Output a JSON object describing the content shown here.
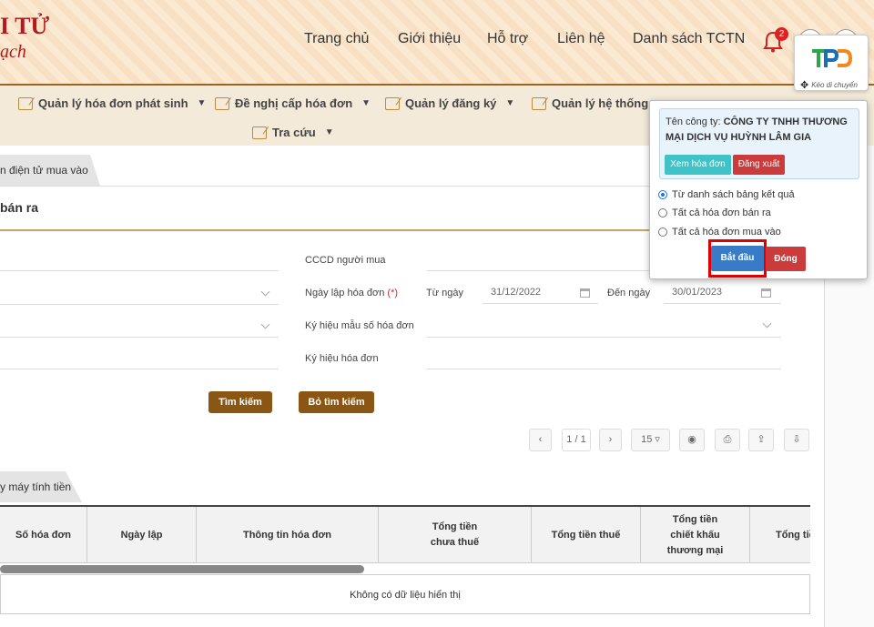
{
  "header": {
    "logo_text": "I TỬ",
    "logo_sub": "ạch",
    "nav": [
      "Trang chủ",
      "Giới thiệu",
      "Hỗ trợ",
      "Liên hệ",
      "Danh sách TCTN"
    ],
    "notification_count": "2"
  },
  "menu": [
    {
      "label": "Quản lý hóa đơn phát sinh"
    },
    {
      "label": "Đề nghị cấp hóa đơn"
    },
    {
      "label": "Quản lý đăng ký"
    },
    {
      "label": "Quản lý hệ thống"
    },
    {
      "label": "Tra cứu"
    }
  ],
  "tabs": {
    "top": "n điện tử mua vào",
    "bottom": "y máy tính tiền"
  },
  "page_title": "bán ra",
  "form": {
    "cccd_label": "CCCD người mua",
    "date_label": "Ngày lập hóa đơn",
    "required_mark": "(*)",
    "from_label": "Từ ngày",
    "from_value": "31/12/2022",
    "to_label": "Đến ngày",
    "to_value": "30/01/2023",
    "template_label": "Ký hiệu mẫu số hóa đơn",
    "symbol_label": "Ký hiệu hóa đơn",
    "search_btn": "Tìm kiếm",
    "clear_btn": "Bỏ tìm kiếm"
  },
  "pagination": {
    "page": "1 / 1",
    "page_size": "15"
  },
  "table": {
    "headers": [
      "Số hóa đơn",
      "Ngày lập",
      "Thông tin hóa đơn",
      "Tổng tiền chưa thuế",
      "Tổng tiền thuế",
      "Tổng tiền chiết khấu thương mại",
      "Tổng tiề"
    ],
    "empty": "Không có dữ liệu hiển thị"
  },
  "popup": {
    "company_label": "Tên công ty:",
    "company_name": "CÔNG TY TNHH THƯƠNG MẠI DỊCH VỤ HUỲNH LÂM GIA",
    "view_btn": "Xem hóa đơn",
    "logout_btn": "Đăng xuất",
    "options": [
      "Từ danh sách bảng kết quả",
      "Tất cả hóa đơn bán ra",
      "Tất cả hóa đơn mua vào"
    ],
    "selected_option": 0,
    "start_btn": "Bắt đầu",
    "close_btn": "Đóng"
  },
  "widget": {
    "logo": "TPD",
    "drag_label": "Kéo di chuyển"
  },
  "colors": {
    "brand_red": "#b3191e",
    "brown_button": "#8b5514",
    "start_blue": "#3a7bc8",
    "close_red": "#cc3b3b",
    "view_teal": "#3fc3c7"
  }
}
